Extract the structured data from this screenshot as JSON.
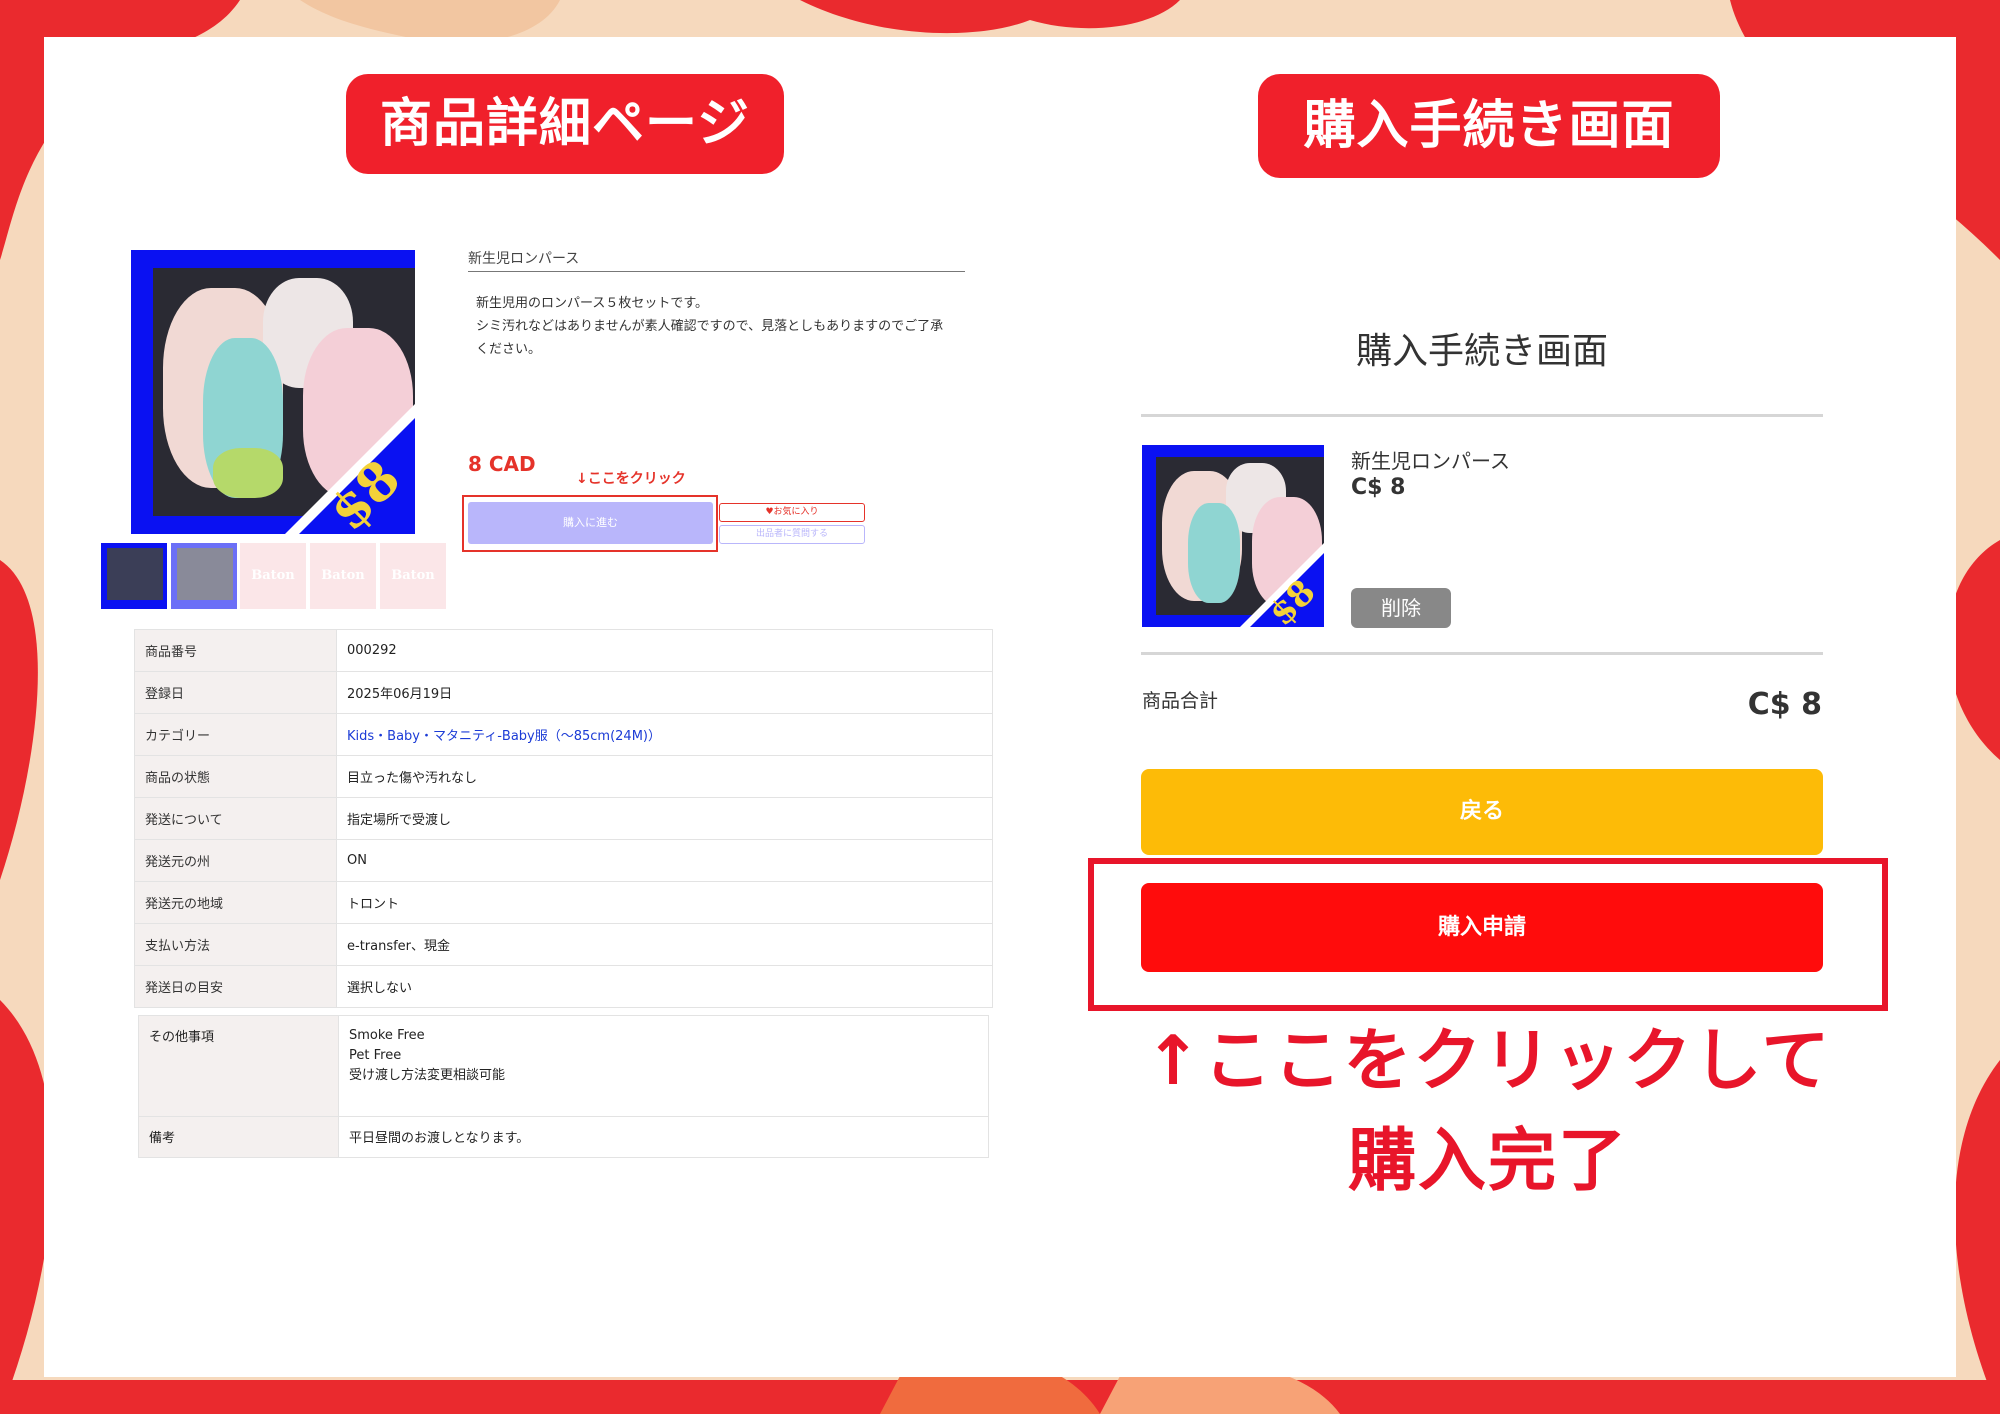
{
  "headings": {
    "left_pill": "商品詳細ページ",
    "right_pill": "購入手続き画面"
  },
  "product": {
    "title": "新生児ロンパース",
    "description_lines": [
      "新生児用のロンパース５枚セットです。",
      "シミ汚れなどはありませんが素人確認ですので、見落としもありますのでご了承",
      "ください。"
    ],
    "price": "8 CAD",
    "click_hint": "↓ここをクリック",
    "buy_button": "購入に進む",
    "favorite_button": "♥お気に入り",
    "ask_button": "出品者に質問する",
    "photo_price_tag": "$8",
    "thumbnail_placeholder": "Baton"
  },
  "specs": [
    {
      "key": "商品番号",
      "value": "000292"
    },
    {
      "key": "登録日",
      "value": "2025年06月19日"
    },
    {
      "key": "カテゴリー",
      "value": "Kids・Baby・マタニティ-Baby服（〜85cm(24M)）"
    },
    {
      "key": "商品の状態",
      "value": "目立った傷や汚れなし"
    },
    {
      "key": "発送について",
      "value": "指定場所で受渡し"
    },
    {
      "key": "発送元の州",
      "value": "ON"
    },
    {
      "key": "発送元の地域",
      "value": "トロント"
    },
    {
      "key": "支払い方法",
      "value": "e-transfer、現金"
    },
    {
      "key": "発送日の目安",
      "value": "選択しない"
    }
  ],
  "other": {
    "key": "その他事項",
    "lines": [
      "Smoke Free",
      "Pet Free",
      "受け渡し方法変更相談可能"
    ]
  },
  "remarks": {
    "key": "備考",
    "value": "平日昼間のお渡しとなります。"
  },
  "checkout": {
    "title": "購入手続き画面",
    "item_name": "新生児ロンパース",
    "item_price": "C$ 8",
    "delete_button": "削除",
    "total_label": "商品合計",
    "total_value": "C$ 8",
    "back_button": "戻る",
    "apply_button": "購入申請",
    "hint_line1": "↑ここをクリックして",
    "hint_line2": "購入完了"
  },
  "colors": {
    "accent_red": "#f0202b",
    "blue_frame": "#0a11f2",
    "back_yellow": "#fdbb07",
    "apply_red": "#ff0c0c"
  }
}
